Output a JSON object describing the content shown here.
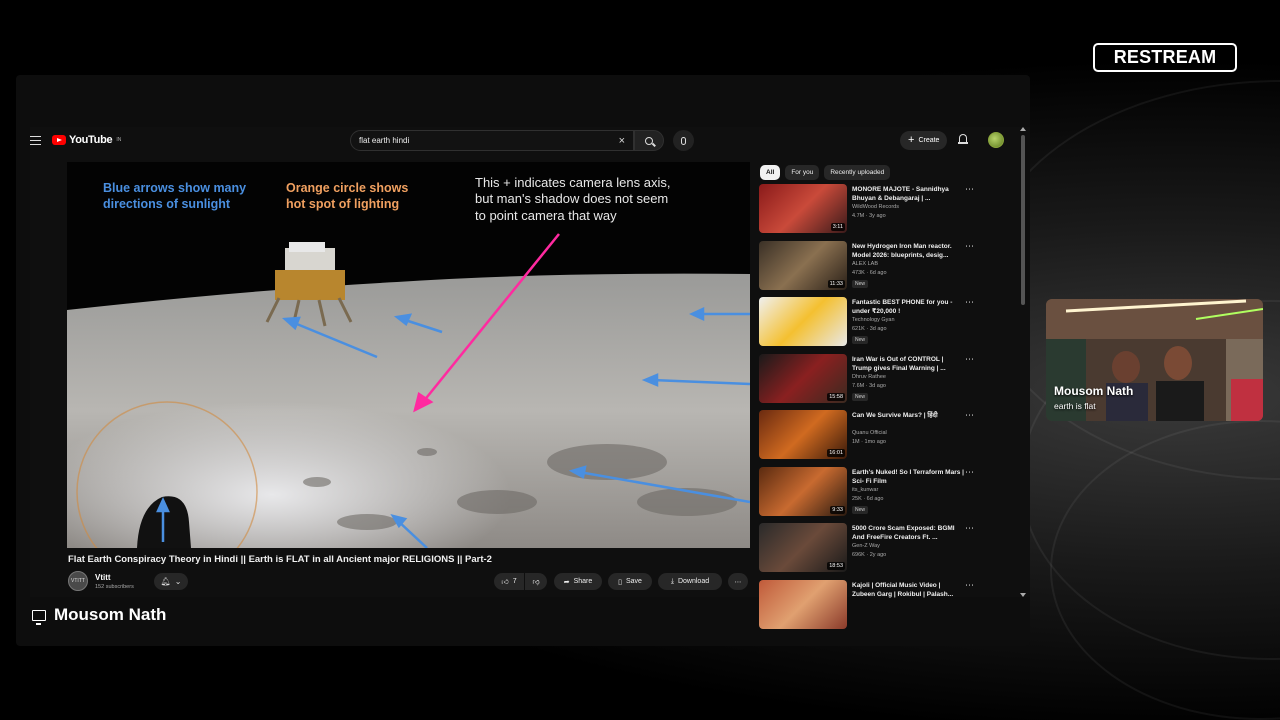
{
  "brand": {
    "logo_text": "RESTREAM"
  },
  "screen_share": {
    "presenter_name": "Mousom Nath",
    "youtube": {
      "logo_text": "YouTube",
      "logo_sup": "IN",
      "search": {
        "value": "flat earth hindi",
        "clear_icon": "×"
      },
      "create_label": "Create",
      "player": {
        "annotations": {
          "blue": [
            "Blue arrows show many",
            "directions of sunlight"
          ],
          "orange": [
            "Orange circle shows",
            "hot spot of lighting"
          ],
          "white": [
            "This + indicates camera lens axis,",
            "but man's shadow does not seem",
            "to point camera that way"
          ]
        }
      },
      "video": {
        "title": "Flat Earth Conspiracy Theory in Hindi || Earth is FLAT in all Ancient major RELIGIONS || Part-2",
        "channel_name": "Vtitt",
        "subscribers": "152 subscribers",
        "likes": "7",
        "share_label": "Share",
        "save_label": "Save",
        "download_label": "Download"
      },
      "chips": [
        "All",
        "For you",
        "Recently uploaded"
      ],
      "recommendations": [
        {
          "title": "MONORE MAJOTE - Sannidhya Bhuyan & Debangaraj | ...",
          "channel": "WildWood Records",
          "meta": "4.7M · 3y ago",
          "duration": "3:11",
          "new": "",
          "thumb": "linear-gradient(135deg,#8a1a1a,#c94a3a 50%,#3a1a1a)"
        },
        {
          "title": "New Hydrogen Iron Man reactor. Model 2026: blueprints, desig...",
          "channel": "ALEX LAB",
          "meta": "473K · 6d ago",
          "duration": "11:33",
          "new": "New",
          "thumb": "linear-gradient(135deg,#3a3026,#8a7050 50%,#2a2018)"
        },
        {
          "title": "Fantastic BEST PHONE for you - under ₹20,000 !",
          "channel": "Technology Gyan",
          "meta": "621K · 3d ago",
          "duration": "",
          "new": "New",
          "thumb": "linear-gradient(135deg,#f0f0f0,#f4c030 50%,#e8e8e8)"
        },
        {
          "title": "Iran War is Out of CONTROL | Trump gives Final Warning | ...",
          "channel": "Dhruv Rathee",
          "meta": "7.6M · 3d ago",
          "duration": "15:58",
          "new": "New",
          "thumb": "linear-gradient(135deg,#1a1a1a,#8a2020 50%,#3a2a20)"
        },
        {
          "title": "Can We Survive Mars? | हिंदी",
          "channel": "Quanu Official",
          "meta": "1M · 1mo ago",
          "duration": "16:01",
          "new": "",
          "thumb": "linear-gradient(135deg,#6a2a10,#d06a20 50%,#3a1a0a)"
        },
        {
          "title": "Earth's Nuked! So I Terraform Mars | Sci- Fi Film",
          "channel": "its_kunwar",
          "meta": "25K · 6d ago",
          "duration": "9:33",
          "new": "New",
          "thumb": "linear-gradient(135deg,#5a2a10,#c86a30 50%,#2a1a10)"
        },
        {
          "title": "5000 Crore Scam Exposed: BGMI And FreeFire Creators Ft. ...",
          "channel": "Gen-Z Way",
          "meta": "696K · 2y ago",
          "duration": "18:53",
          "new": "",
          "thumb": "linear-gradient(135deg,#2a2a2a,#6a4a3a 50%,#1a1a1a)"
        },
        {
          "title": "Kajoli | Official Music Video | Zubeen Garg | Rokibul | Palash...",
          "channel": "",
          "meta": "",
          "duration": "",
          "new": "",
          "thumb": "linear-gradient(135deg,#c05a3a,#e0a070 50%,#8a3a2a)"
        }
      ]
    }
  },
  "webcam": {
    "name": "Mousom Nath",
    "caption": "earth is flat"
  }
}
